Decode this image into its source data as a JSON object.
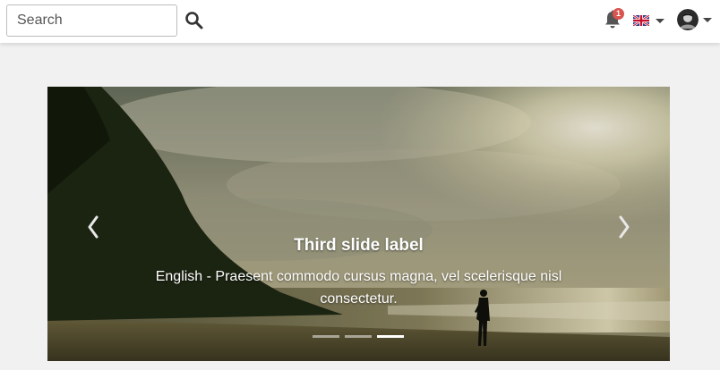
{
  "header": {
    "search": {
      "placeholder": "Search",
      "value": ""
    },
    "search_button_icon": "search-icon",
    "notifications": {
      "icon": "bell-icon",
      "count": "1",
      "badge_color": "#d9534f"
    },
    "language": {
      "icon": "uk-flag-icon"
    },
    "user": {
      "icon": "avatar"
    }
  },
  "carousel": {
    "active_index": 2,
    "slide_count": 3,
    "caption": {
      "title": "Third slide label",
      "text": "English - Praesent commodo cursus magna, vel scelerisque nisl consectetur."
    },
    "controls": {
      "prev_icon": "chevron-left-icon",
      "next_icon": "chevron-right-icon"
    }
  },
  "colors": {
    "page_background": "#f1f1f1",
    "topbar_background": "#ffffff",
    "caption_color": "#ffffff"
  }
}
